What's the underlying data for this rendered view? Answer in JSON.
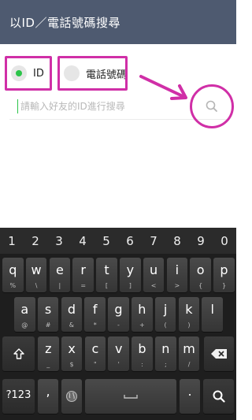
{
  "header": {
    "title": "以ID／電話號碼搜尋"
  },
  "radio": {
    "options": [
      {
        "label": "ID",
        "selected": true
      },
      {
        "label": "電話號碼",
        "selected": false
      }
    ]
  },
  "search": {
    "placeholder": "請輸入好友的ID進行搜尋",
    "value": ""
  },
  "keyboard": {
    "number_row": [
      "1",
      "2",
      "3",
      "4",
      "5",
      "6",
      "7",
      "8",
      "9",
      "0"
    ],
    "row1": [
      {
        "key": "q",
        "sub": "%"
      },
      {
        "key": "w",
        "sub": "\\"
      },
      {
        "key": "e",
        "sub": "|"
      },
      {
        "key": "r",
        "sub": "="
      },
      {
        "key": "t",
        "sub": "["
      },
      {
        "key": "y",
        "sub": "]"
      },
      {
        "key": "u",
        "sub": "<"
      },
      {
        "key": "i",
        "sub": ">"
      },
      {
        "key": "o",
        "sub": "{"
      },
      {
        "key": "p",
        "sub": "}"
      }
    ],
    "row2": [
      {
        "key": "a",
        "sub": "@"
      },
      {
        "key": "s",
        "sub": "#"
      },
      {
        "key": "d",
        "sub": "&"
      },
      {
        "key": "f",
        "sub": "*"
      },
      {
        "key": "g",
        "sub": "-"
      },
      {
        "key": "h",
        "sub": "+"
      },
      {
        "key": "j",
        "sub": "("
      },
      {
        "key": "k",
        "sub": ")"
      },
      {
        "key": "l",
        "sub": ""
      }
    ],
    "row3": [
      {
        "key": "z",
        "sub": "_"
      },
      {
        "key": "x",
        "sub": "$"
      },
      {
        "key": "c",
        "sub": "\""
      },
      {
        "key": "v",
        "sub": "'"
      },
      {
        "key": "b",
        "sub": ":"
      },
      {
        "key": "n",
        "sub": ";"
      },
      {
        "key": "m",
        "sub": "/"
      }
    ],
    "bottom": {
      "symbols_label": "?123",
      "comma": ",",
      "period": "."
    }
  },
  "colors": {
    "header_bg": "#4e5a70",
    "accent": "#2cc44a",
    "highlight": "#d02fa7"
  }
}
